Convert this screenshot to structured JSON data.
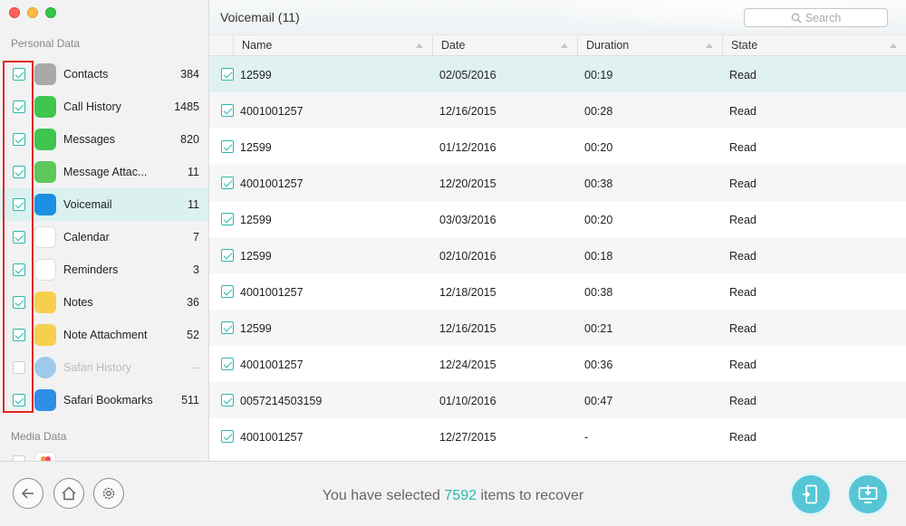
{
  "sidebar": {
    "section_personal": "Personal Data",
    "section_media": "Media Data",
    "items": [
      {
        "label": "Contacts",
        "count": "384",
        "checked": true,
        "icon": "contacts-icon",
        "color": "#a9a9a9"
      },
      {
        "label": "Call History",
        "count": "1485",
        "checked": true,
        "icon": "phone-icon",
        "color": "#3ec64e"
      },
      {
        "label": "Messages",
        "count": "820",
        "checked": true,
        "icon": "messages-icon",
        "color": "#3ec64e"
      },
      {
        "label": "Message Attac...",
        "count": "11",
        "checked": true,
        "icon": "paperclip-icon",
        "color": "#5cc85c"
      },
      {
        "label": "Voicemail",
        "count": "11",
        "checked": true,
        "icon": "voicemail-icon",
        "color": "#1a8fe3",
        "active": true
      },
      {
        "label": "Calendar",
        "count": "7",
        "checked": true,
        "icon": "calendar-icon",
        "color": "#ffffff"
      },
      {
        "label": "Reminders",
        "count": "3",
        "checked": true,
        "icon": "reminders-icon",
        "color": "#ffffff"
      },
      {
        "label": "Notes",
        "count": "36",
        "checked": true,
        "icon": "notes-icon",
        "color": "#f6d04d"
      },
      {
        "label": "Note Attachment",
        "count": "52",
        "checked": true,
        "icon": "note-attachment-icon",
        "color": "#f6d04d"
      },
      {
        "label": "Safari History",
        "count": "--",
        "checked": false,
        "icon": "safari-history-icon",
        "color": "#9ec9ea",
        "disabled": true
      },
      {
        "label": "Safari Bookmarks",
        "count": "511",
        "checked": true,
        "icon": "safari-bookmarks-icon",
        "color": "#2f8ee5"
      }
    ]
  },
  "main": {
    "title": "Voicemail (11)",
    "search_placeholder": "Search",
    "columns": [
      "Name",
      "Date",
      "Duration",
      "State"
    ],
    "rows": [
      {
        "name": "12599",
        "date": "02/05/2016",
        "duration": "00:19",
        "state": "Read"
      },
      {
        "name": "4001001257",
        "date": "12/16/2015",
        "duration": "00:28",
        "state": "Read"
      },
      {
        "name": "12599",
        "date": "01/12/2016",
        "duration": "00:20",
        "state": "Read"
      },
      {
        "name": "4001001257",
        "date": "12/20/2015",
        "duration": "00:38",
        "state": "Read"
      },
      {
        "name": "12599",
        "date": "03/03/2016",
        "duration": "00:20",
        "state": "Read"
      },
      {
        "name": "12599",
        "date": "02/10/2016",
        "duration": "00:18",
        "state": "Read"
      },
      {
        "name": "4001001257",
        "date": "12/18/2015",
        "duration": "00:38",
        "state": "Read"
      },
      {
        "name": "12599",
        "date": "12/16/2015",
        "duration": "00:21",
        "state": "Read"
      },
      {
        "name": "4001001257",
        "date": "12/24/2015",
        "duration": "00:36",
        "state": "Read"
      },
      {
        "name": "0057214503159",
        "date": "01/10/2016",
        "duration": "00:47",
        "state": "Read"
      },
      {
        "name": "4001001257",
        "date": "12/27/2015",
        "duration": "-",
        "state": "Read"
      }
    ]
  },
  "bottom": {
    "status_prefix": "You have selected",
    "status_count": "7592",
    "status_suffix": "items to recover"
  },
  "colors": {
    "accent": "#2bb7ad",
    "highlight_box": "#e0271e",
    "action_button": "#56c6d6"
  }
}
